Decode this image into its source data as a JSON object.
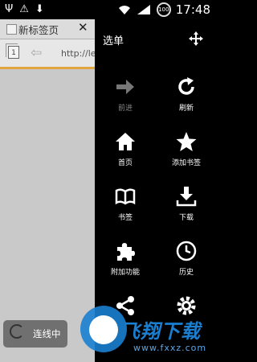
{
  "status_bar": {
    "time": "17:48",
    "battery": "100",
    "icons": [
      "usb-icon",
      "usb-debug-icon",
      "download-icon",
      "wifi-icon",
      "signal-icon",
      "battery-icon"
    ]
  },
  "browser": {
    "tab_title": "新标签页",
    "tab_close": "✕",
    "tab_count": "1",
    "url": "http://lex"
  },
  "connection": {
    "label": "连线中"
  },
  "menu": {
    "title": "选单",
    "items": [
      {
        "label": "前进",
        "icon": "forward-arrow-icon",
        "enabled": false
      },
      {
        "label": "刷新",
        "icon": "refresh-icon",
        "enabled": true
      },
      {
        "label": "首页",
        "icon": "home-icon",
        "enabled": true
      },
      {
        "label": "添加书签",
        "icon": "star-icon",
        "enabled": true
      },
      {
        "label": "书签",
        "icon": "book-icon",
        "enabled": true
      },
      {
        "label": "下载",
        "icon": "download-icon",
        "enabled": true
      },
      {
        "label": "附加功能",
        "icon": "puzzle-icon",
        "enabled": true
      },
      {
        "label": "历史",
        "icon": "clock-icon",
        "enabled": true
      },
      {
        "label": "",
        "icon": "share-icon",
        "enabled": true
      },
      {
        "label": "",
        "icon": "gear-icon",
        "enabled": true
      }
    ]
  },
  "watermark": {
    "text": "飞翔下载",
    "url": "www.fxxz.com"
  },
  "colors": {
    "progress": "#e2a540",
    "accent": "#1a7fd0"
  }
}
